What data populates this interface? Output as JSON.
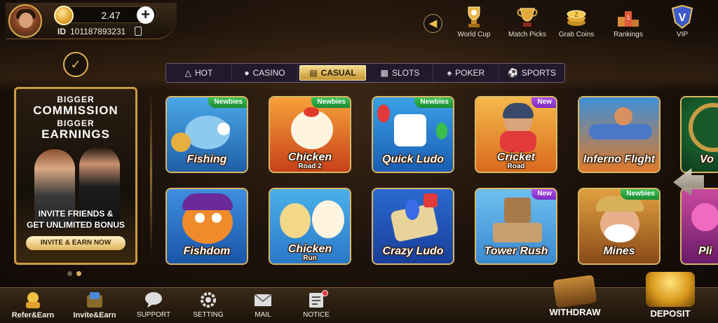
{
  "user": {
    "balance": "2.47",
    "id_label": "ID",
    "id_value": "101187893231"
  },
  "top_nav": [
    {
      "label": "World Cup",
      "icon": "trophy-icon"
    },
    {
      "label": "Match Picks",
      "icon": "cup-icon"
    },
    {
      "label": "Grab Coins",
      "icon": "coins-icon"
    },
    {
      "label": "Rankings",
      "icon": "podium-icon"
    },
    {
      "label": "VIP",
      "icon": "vip-badge-icon"
    }
  ],
  "tabs": [
    {
      "label": "HOT",
      "icon": "fire-icon"
    },
    {
      "label": "CASINO",
      "icon": "casino-icon"
    },
    {
      "label": "CASUAL",
      "icon": "gamepad-icon",
      "active": true
    },
    {
      "label": "SLOTS",
      "icon": "slots-icon"
    },
    {
      "label": "POKER",
      "icon": "cards-icon"
    },
    {
      "label": "SPORTS",
      "icon": "ball-icon"
    }
  ],
  "promo": {
    "line1": "BIGGER",
    "line2": "COMMISSION",
    "line3": "BIGGER",
    "line4": "EARNINGS",
    "invite_line1": "INVITE FRIENDS &",
    "invite_line2": "GET UNLIMITED BONUS",
    "button": "INVITE & EARN NOW"
  },
  "games": [
    {
      "name": "Fishing",
      "sub": "",
      "badge": "Newbies"
    },
    {
      "name": "Chicken",
      "sub": "Road 2",
      "badge": "Newbies"
    },
    {
      "name": "Quick Ludo",
      "sub": "",
      "badge": "Newbies"
    },
    {
      "name": "Cricket",
      "sub": "Road",
      "badge": "New"
    },
    {
      "name": "Inferno Flight",
      "sub": "",
      "badge": ""
    },
    {
      "name": "Vo",
      "sub": "",
      "badge": ""
    },
    {
      "name": "Fishdom",
      "sub": "",
      "badge": ""
    },
    {
      "name": "Chicken",
      "sub": "Run",
      "badge": ""
    },
    {
      "name": "Crazy Ludo",
      "sub": "",
      "badge": ""
    },
    {
      "name": "Tower Rush",
      "sub": "",
      "badge": "New"
    },
    {
      "name": "Mines",
      "sub": "",
      "badge": "Newbies"
    },
    {
      "name": "Pli",
      "sub": "",
      "badge": ""
    }
  ],
  "bottom_nav": [
    {
      "label": "Refer&Earn",
      "icon": "refer-icon"
    },
    {
      "label": "Invite&Earn",
      "icon": "invite-icon"
    },
    {
      "label": "SUPPORT",
      "icon": "chat-icon"
    },
    {
      "label": "SETTING",
      "icon": "gear-icon"
    },
    {
      "label": "MAIL",
      "icon": "mail-icon"
    },
    {
      "label": "NOTICE",
      "icon": "notice-icon"
    }
  ],
  "actions": {
    "withdraw": "WITHDRAW",
    "deposit": "DEPOSIT"
  }
}
